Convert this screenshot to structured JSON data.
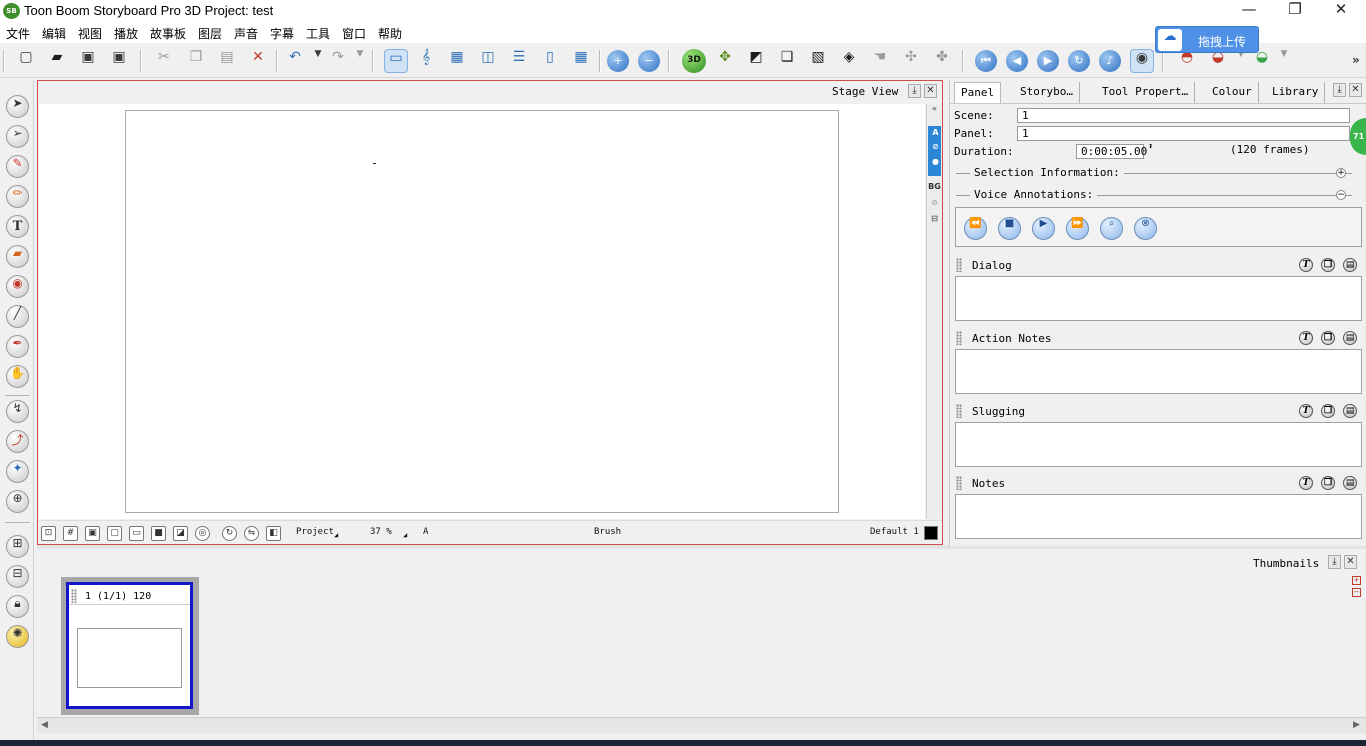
{
  "window": {
    "title": "Toon Boom Storyboard Pro 3D Project: test",
    "logo": "SB",
    "minimize": "—",
    "restore": "❐",
    "close": "✕"
  },
  "menu": [
    "文件",
    "编辑",
    "视图",
    "播放",
    "故事板",
    "图层",
    "声音",
    "字幕",
    "工具",
    "窗口",
    "帮助"
  ],
  "upload_badge": {
    "label": "拖拽上传",
    "icon": "cloud-icon"
  },
  "toolbar": {
    "file": [
      "new-icon",
      "open-icon",
      "save-icon",
      "save-all-icon"
    ],
    "edit": [
      "cut-icon",
      "copy-icon",
      "paste-icon",
      "delete-icon"
    ],
    "history": [
      "undo-icon",
      "redo-icon"
    ],
    "views": [
      "timeline-view-icon",
      "sound-icon",
      "grid-view-icon",
      "two-panel-icon",
      "three-panel-icon",
      "stage-view-icon",
      "thumbnails-view-icon"
    ],
    "zoom": [
      "zoom-in-icon",
      "zoom-out-icon"
    ],
    "scene": [
      "3d-icon",
      "new-panel-icon",
      "new-scene-icon",
      "duplicate-icon",
      "split-icon",
      "merge-icon",
      "hand-icon",
      "camera-move-icon",
      "camera-reset-icon"
    ],
    "playback": [
      "first-frame-icon",
      "previous-icon",
      "play-icon",
      "loop-icon",
      "sound-playback-icon",
      "camera-icon"
    ],
    "onion": [
      "onion-skin-icon",
      "light-table-icon",
      "onion-green-icon"
    ],
    "more": "»"
  },
  "left_tools": [
    "select-icon",
    "contour-editor-icon",
    "brush-icon",
    "pencil-icon",
    "text-icon",
    "eraser-icon",
    "paint-icon",
    "line-icon",
    "eyedropper-icon",
    "hand-icon",
    "motion-path-icon",
    "pivot-icon",
    "camera-tool-icon",
    "crosshair-icon",
    "add-layer-icon",
    "remove-layer-icon",
    "lock-icon",
    "light-icon"
  ],
  "stage": {
    "tab_label": "Stage View",
    "layers": [
      "A",
      "BG"
    ],
    "status": {
      "mode": "Project",
      "zoom": "37 %",
      "layer": "A",
      "tool": "Brush",
      "preset": "Default 1",
      "swatch_color": "#000000"
    }
  },
  "right_panel": {
    "tabs": [
      "Panel",
      "Storybo…",
      "Tool Propert…",
      "Colour",
      "Library"
    ],
    "scene_label": "Scene:",
    "scene_value": "1",
    "panel_label": "Panel:",
    "panel_value": "1",
    "duration_label": "Duration:",
    "duration_value": "0:00:05.00",
    "frames_text": "(120 frames)",
    "selection_info": "Selection Information:",
    "voice_annotations": "Voice Annotations:",
    "sections": [
      "Dialog",
      "Action Notes",
      "Slugging",
      "Notes"
    ],
    "side_badge": "71"
  },
  "thumbnails": {
    "tab_label": "Thumbnails",
    "items": [
      {
        "caption": "1 (1/1) 120"
      }
    ]
  },
  "colors": {
    "accent_border": "#d24b4b",
    "selection_blue": "#1414c8",
    "upload_blue": "#4f91e6"
  }
}
